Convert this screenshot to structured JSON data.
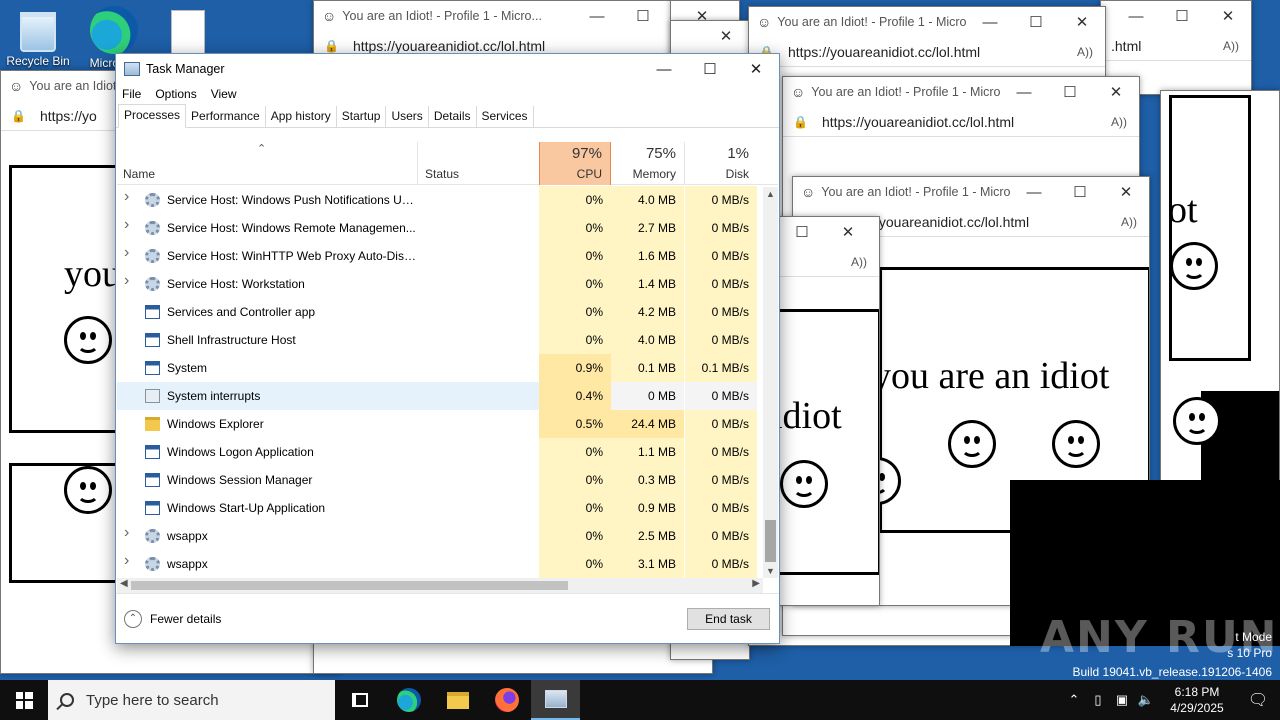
{
  "desktop": {
    "icons": [
      {
        "label": "Recycle Bin"
      },
      {
        "label": "Microsoft Edge"
      },
      {
        "label": ""
      }
    ]
  },
  "browser_popups": {
    "title": "You are an Idiot! - Profile 1 - Micro...",
    "url": "https://youareanidiot.cc/lol.html",
    "url_partial": "https://yo",
    "url_partial_b": "/youareanidiot.cc/lol.html",
    "url_partial_c": ".html",
    "title_partial": "You are an Idiot",
    "content_text": "you are an idiot",
    "content_text_partial_a": "you",
    "content_text_partial_b": "idiot",
    "content_text_partial_c": "ot"
  },
  "task_manager": {
    "title": "Task Manager",
    "menu": [
      "File",
      "Options",
      "View"
    ],
    "tabs": [
      "Processes",
      "Performance",
      "App history",
      "Startup",
      "Users",
      "Details",
      "Services"
    ],
    "active_tab": "Processes",
    "columns": {
      "name": "Name",
      "status": "Status",
      "cpu": {
        "pct": "97%",
        "label": "CPU"
      },
      "memory": {
        "pct": "75%",
        "label": "Memory"
      },
      "disk": {
        "pct": "1%",
        "label": "Disk"
      }
    },
    "rows": [
      {
        "name": "Service Host: Windows Push Notifications Us...",
        "icon": "gear",
        "expandable": true,
        "cpu": "0%",
        "memory": "4.0 MB",
        "disk": "0 MB/s"
      },
      {
        "name": "Service Host: Windows Remote Managemen...",
        "icon": "gear",
        "expandable": true,
        "cpu": "0%",
        "memory": "2.7 MB",
        "disk": "0 MB/s"
      },
      {
        "name": "Service Host: WinHTTP Web Proxy Auto-Disc...",
        "icon": "gear",
        "expandable": true,
        "cpu": "0%",
        "memory": "1.6 MB",
        "disk": "0 MB/s"
      },
      {
        "name": "Service Host: Workstation",
        "icon": "gear",
        "expandable": true,
        "cpu": "0%",
        "memory": "1.4 MB",
        "disk": "0 MB/s"
      },
      {
        "name": "Services and Controller app",
        "icon": "window",
        "expandable": false,
        "cpu": "0%",
        "memory": "4.2 MB",
        "disk": "0 MB/s"
      },
      {
        "name": "Shell Infrastructure Host",
        "icon": "window",
        "expandable": false,
        "cpu": "0%",
        "memory": "4.0 MB",
        "disk": "0 MB/s"
      },
      {
        "name": "System",
        "icon": "window",
        "expandable": false,
        "cpu": "0.9%",
        "memory": "0.1 MB",
        "disk": "0.1 MB/s"
      },
      {
        "name": "System interrupts",
        "icon": "system",
        "expandable": false,
        "cpu": "0.4%",
        "memory": "0 MB",
        "disk": "0 MB/s",
        "selected": true
      },
      {
        "name": "Windows Explorer",
        "icon": "folder",
        "expandable": false,
        "cpu": "0.5%",
        "memory": "24.4 MB",
        "disk": "0 MB/s"
      },
      {
        "name": "Windows Logon Application",
        "icon": "window",
        "expandable": false,
        "cpu": "0%",
        "memory": "1.1 MB",
        "disk": "0 MB/s"
      },
      {
        "name": "Windows Session Manager",
        "icon": "window",
        "expandable": false,
        "cpu": "0%",
        "memory": "0.3 MB",
        "disk": "0 MB/s"
      },
      {
        "name": "Windows Start-Up Application",
        "icon": "window",
        "expandable": false,
        "cpu": "0%",
        "memory": "0.9 MB",
        "disk": "0 MB/s"
      },
      {
        "name": "wsappx",
        "icon": "gear",
        "expandable": true,
        "cpu": "0%",
        "memory": "2.5 MB",
        "disk": "0 MB/s"
      },
      {
        "name": "wsappx",
        "icon": "gear",
        "expandable": true,
        "cpu": "0%",
        "memory": "3.1 MB",
        "disk": "0 MB/s"
      }
    ],
    "fewer_details": "Fewer details",
    "end_task": "End task",
    "colors": {
      "cpu_header": "#f9c7a0",
      "cell_light": "#fff4c4",
      "cell_mid": "#ffe8a3",
      "selected": "#e5f1fb"
    }
  },
  "taskbar": {
    "search_placeholder": "Type here to search",
    "time": "6:18 PM",
    "date": "4/29/2025"
  },
  "watermark": {
    "line1": "t Mode",
    "line2": "s 10 Pro",
    "line3": "Build 19041.vb_release.191206-1406",
    "anyrun": "ANY RUN"
  }
}
